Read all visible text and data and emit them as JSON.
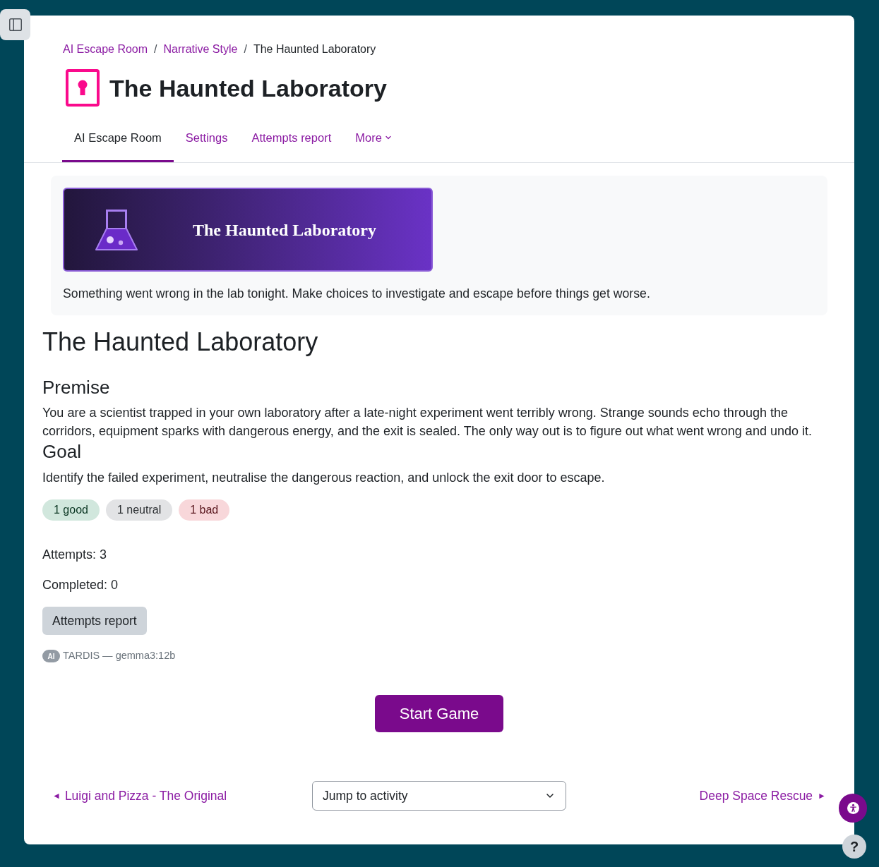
{
  "breadcrumb": {
    "separator": "/",
    "items": [
      {
        "label": "AI Escape Room",
        "current": false
      },
      {
        "label": "Narrative Style",
        "current": false
      },
      {
        "label": "The Haunted Laboratory",
        "current": true
      }
    ]
  },
  "page_title": "The Haunted Laboratory",
  "tabs": [
    {
      "label": "AI Escape Room",
      "kind": "link",
      "selected": true
    },
    {
      "label": "Settings",
      "kind": "link",
      "selected": false
    },
    {
      "label": "Attempts report",
      "kind": "link",
      "selected": false
    },
    {
      "label": "More",
      "kind": "menu",
      "selected": false
    }
  ],
  "intro": {
    "banner_title": "The Haunted Laboratory",
    "description": "Something went wrong in the lab tonight. Make choices to investigate and escape before things get worse."
  },
  "heading": "The Haunted Laboratory",
  "sections": [
    {
      "title": "Premise",
      "text": "You are a scientist trapped in your own laboratory after a late-night experiment went terribly wrong. Strange sounds echo through the corridors, equipment sparks with dangerous energy, and the exit is sealed. The only way out is to figure out what went wrong and undo it."
    },
    {
      "title": "Goal",
      "text": "Identify the failed experiment, neutralise the dangerous reaction, and unlock the exit door to escape."
    }
  ],
  "outcome_badges": [
    {
      "label": "1 good",
      "kind": "good"
    },
    {
      "label": "1 neutral",
      "kind": "neutral"
    },
    {
      "label": "1 bad",
      "kind": "bad"
    }
  ],
  "stats": [
    "Attempts: 3",
    "Completed: 0"
  ],
  "report_button": "Attempts report",
  "model_info": {
    "badge": "AI",
    "text": "TARDIS — gemma3:12b"
  },
  "start_button": "Start Game",
  "activity_nav": {
    "previous": {
      "arrow": "◄",
      "label": "Luigi and Pizza - The Original"
    },
    "jump_select": {
      "value": "Jump to activity"
    },
    "next": {
      "label": "Deep Space Rescue",
      "arrow": "►"
    }
  },
  "help_button": "?"
}
